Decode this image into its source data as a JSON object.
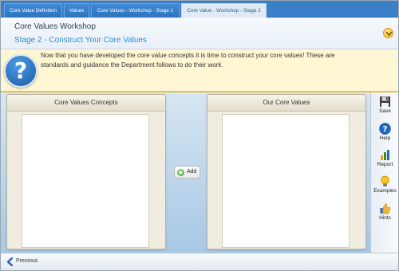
{
  "tabs": [
    {
      "label": "Core Value Definition"
    },
    {
      "label": "Values"
    },
    {
      "label": "Core Values - Workshop - Stage 1"
    },
    {
      "label": "Core Value - Workshop - Stage 2",
      "active": true
    }
  ],
  "header": {
    "title": "Core Values Workshop",
    "subtitle": "Stage 2 - Construct Your Core Values"
  },
  "info": {
    "icon": "question-mark-icon",
    "text": "Now that you have developed the core value concepts it is time to construct your core values! These are standards and guidance the Department follows to do their work."
  },
  "panels": {
    "left": {
      "title": "Core Values Concepts"
    },
    "right": {
      "title": "Our Core Values"
    }
  },
  "add_button": {
    "label": "Add"
  },
  "toolbar": {
    "items": [
      {
        "label": "Save",
        "icon": "floppy-disk-icon"
      },
      {
        "label": "Help",
        "icon": "help-icon"
      },
      {
        "label": "Report",
        "icon": "report-icon"
      },
      {
        "label": "Examples",
        "icon": "lightbulb-icon"
      },
      {
        "label": "Hints",
        "icon": "thumbs-up-icon"
      }
    ]
  },
  "footer": {
    "previous_label": "Previous"
  },
  "colors": {
    "tab_bar": "#3a7fc8",
    "subtitle": "#2a8fd0",
    "banner": "#fff6d4",
    "banner_border": "#f2c040",
    "panel": "#f0ece0"
  }
}
